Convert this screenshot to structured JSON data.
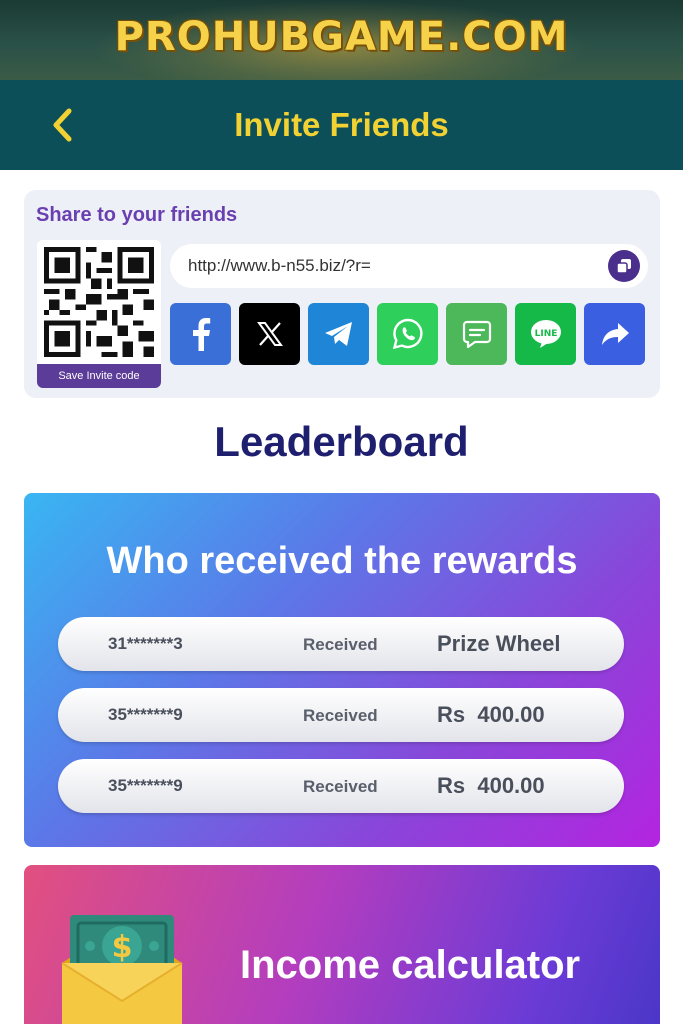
{
  "banner": {
    "text": "PROHUBGAME.COM"
  },
  "header": {
    "title": "Invite Friends",
    "back_icon": "chevron-left-icon"
  },
  "share": {
    "title": "Share to your friends",
    "save_invite_label": "Save Invite code",
    "url": "http://www.b-n55.biz/?r=",
    "buttons": [
      {
        "name": "facebook",
        "icon": "facebook-icon",
        "color": "#3a6fd8"
      },
      {
        "name": "x",
        "icon": "x-icon",
        "color": "#000000"
      },
      {
        "name": "telegram",
        "icon": "telegram-icon",
        "color": "#1f85d6"
      },
      {
        "name": "whatsapp",
        "icon": "whatsapp-icon",
        "color": "#2ecf5b"
      },
      {
        "name": "sms",
        "icon": "message-icon",
        "color": "#4cb85a"
      },
      {
        "name": "line",
        "icon": "line-icon",
        "color": "#15b948"
      },
      {
        "name": "share",
        "icon": "share-icon",
        "color": "#3a5fe0"
      }
    ],
    "line_label": "LINE"
  },
  "leaderboard": {
    "title": "Leaderboard",
    "rewards_title": "Who received the rewards",
    "rows": [
      {
        "id": "31*******3",
        "status": "Received",
        "reward": "Prize Wheel"
      },
      {
        "id": "35*******9",
        "status": "Received",
        "reward": "Rs  400.00"
      },
      {
        "id": "35*******9",
        "status": "Received",
        "reward": "Rs  400.00"
      }
    ]
  },
  "income": {
    "title": "Income calculator",
    "icon": "money-envelope-icon"
  },
  "colors": {
    "header_bg": "#0d4f58",
    "header_title": "#f2d232",
    "accent_purple": "#6a3fb0",
    "leaderboard_title": "#1e1f6e"
  }
}
